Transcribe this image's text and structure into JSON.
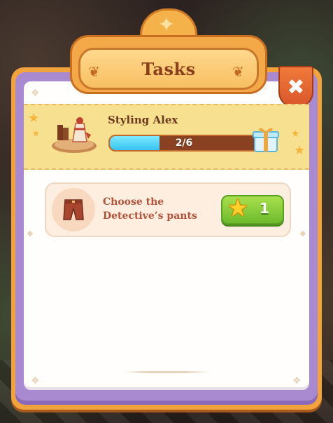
{
  "dialog": {
    "title": "Tasks",
    "close_label": "✖"
  },
  "banner": {
    "title": "Styling Alex",
    "progress": {
      "current": 2,
      "total": 6,
      "text": "2/6",
      "fraction": 0.333
    },
    "thumbnail_icon": "dress-mannequin-icon",
    "reward_icon": "gift-box-icon"
  },
  "tasks": [
    {
      "icon": "pants-icon",
      "text_line1": "Choose the",
      "text_line2": "Detective’s pants",
      "reward_icon": "star-icon",
      "reward_count": "1"
    }
  ],
  "colors": {
    "panel_border": "#f2a33c",
    "panel_purple": "#a98ad0",
    "banner": "#f7e08f",
    "progress_fill": "#36c4ef",
    "reward_button": "#6dbb2c",
    "close_button": "#e0602e"
  }
}
